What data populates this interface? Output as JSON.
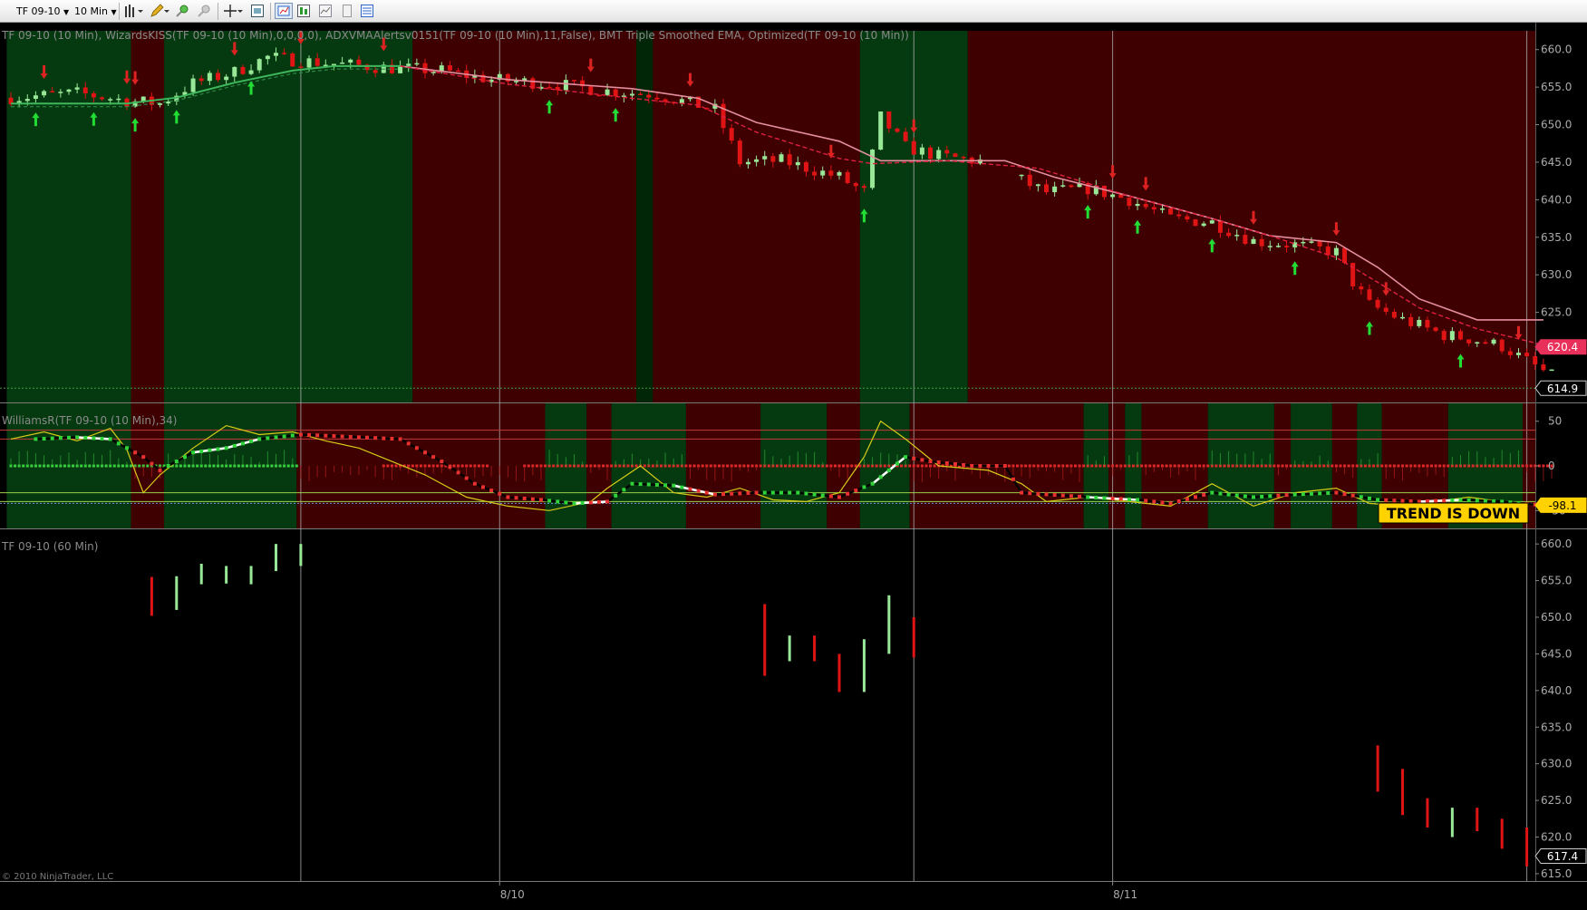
{
  "toolbar": {
    "instrument": "TF 09-10",
    "interval": "10 Min",
    "icons": [
      "bar-style-icon",
      "drawing-pencil-icon",
      "zoom-in-icon",
      "zoom-out-icon",
      "crosshair-icon",
      "data-box-icon",
      "properties-icon",
      "indicators-icon",
      "strategies-icon",
      "templates-icon",
      "chart-trader-icon"
    ]
  },
  "panels": {
    "price_title": "TF 09-10 (10 Min), WizardsKISS(TF 09-10 (10 Min),0,0,0,0), ADXVMAAlertsv0151(TF 09-10 (10 Min),11,False), BMT Triple Smoothed EMA, Optimized(TF 09-10 (10 Min))",
    "williams_title": "WilliamsR(TF 09-10 (10 Min),34)",
    "hourly_title": "TF 09-10 (60 Min)",
    "copyright": "© 2010 NinjaTrader, LLC",
    "trend_text": "TREND IS DOWN"
  },
  "chart_data": [
    {
      "type": "candlestick",
      "name": "price-10min",
      "ylim": [
        613,
        662.5
      ],
      "yticks": [
        "660.0",
        "655.0",
        "650.0",
        "645.0",
        "640.0",
        "635.0",
        "630.0",
        "625.0",
        "620.0",
        "615.0"
      ],
      "ytick_values": [
        660,
        655,
        650,
        645,
        640,
        635,
        630,
        625,
        620,
        615
      ],
      "price_markers": [
        {
          "label": "620.4",
          "value": 620.4,
          "color": "#e8305a"
        },
        {
          "label": "614.9",
          "value": 614.9,
          "color": "#000000"
        }
      ],
      "xlabels": [
        {
          "label": "8/10",
          "bar": 59
        },
        {
          "label": "8/11",
          "bar": 133
        }
      ],
      "waypoints": [
        [
          0,
          653.6
        ],
        [
          8,
          654.2
        ],
        [
          14,
          653.2
        ],
        [
          18,
          652.8
        ],
        [
          22,
          655.5
        ],
        [
          27,
          657
        ],
        [
          31,
          659
        ],
        [
          35,
          658.5
        ],
        [
          38,
          658.2
        ],
        [
          45,
          657.6
        ],
        [
          52,
          657.2
        ],
        [
          58,
          656
        ],
        [
          65,
          655.5
        ],
        [
          72,
          654.5
        ],
        [
          78,
          654
        ],
        [
          85,
          652
        ],
        [
          88,
          645
        ],
        [
          93,
          645.2
        ],
        [
          100,
          643
        ],
        [
          103,
          641
        ],
        [
          105,
          651
        ],
        [
          108,
          647
        ],
        [
          112,
          645.8
        ],
        [
          118,
          645
        ],
        [
          123,
          642
        ],
        [
          125,
          641
        ],
        [
          130,
          641.5
        ],
        [
          135,
          640
        ],
        [
          140,
          637.5
        ],
        [
          145,
          637
        ],
        [
          150,
          634.5
        ],
        [
          155,
          634
        ],
        [
          160,
          633
        ],
        [
          162,
          629
        ],
        [
          164,
          626
        ],
        [
          168,
          624
        ],
        [
          173,
          622
        ],
        [
          176,
          621.5
        ],
        [
          180,
          620.5
        ],
        [
          183,
          618.5
        ],
        [
          186,
          616.5
        ]
      ],
      "fast_line": [
        [
          0,
          652.8
        ],
        [
          14,
          652.8
        ],
        [
          20,
          653.6
        ],
        [
          27,
          655.6
        ],
        [
          34,
          657.2
        ],
        [
          39,
          657.8
        ],
        [
          47,
          657.8
        ]
      ],
      "smooth_line": [
        [
          47,
          657.8
        ],
        [
          60,
          656
        ],
        [
          75,
          654.8
        ],
        [
          83,
          653.5
        ],
        [
          90,
          650.3
        ],
        [
          100,
          647.8
        ],
        [
          105,
          645.2
        ],
        [
          113,
          645.2
        ],
        [
          120,
          645.2
        ],
        [
          126,
          643
        ],
        [
          135,
          640.5
        ],
        [
          145,
          637.5
        ],
        [
          152,
          635.2
        ],
        [
          160,
          634.3
        ],
        [
          165,
          631
        ],
        [
          170,
          626.8
        ],
        [
          177,
          624
        ],
        [
          185,
          624
        ]
      ],
      "dashed_line": [
        [
          47,
          657.8
        ],
        [
          60,
          655.4
        ],
        [
          75,
          653.5
        ],
        [
          83,
          652.6
        ],
        [
          90,
          649
        ],
        [
          100,
          645.5
        ],
        [
          104,
          644.8
        ],
        [
          113,
          645.2
        ],
        [
          124,
          644.2
        ],
        [
          135,
          640.5
        ],
        [
          145,
          637.5
        ],
        [
          152,
          635.2
        ],
        [
          160,
          632.3
        ],
        [
          165,
          629
        ],
        [
          170,
          625.6
        ],
        [
          177,
          622.8
        ],
        [
          186,
          620.4
        ]
      ],
      "bg_segments": [
        [
          0,
          15,
          "G"
        ],
        [
          15,
          19,
          "R"
        ],
        [
          19,
          49,
          "G"
        ],
        [
          49,
          103,
          "R"
        ],
        [
          103,
          116,
          "G"
        ],
        [
          116,
          188,
          "R"
        ]
      ],
      "bg_dark_bands": [
        [
          76,
          78
        ]
      ],
      "down_arrows": [
        4,
        14,
        15,
        27,
        35,
        45,
        70,
        82,
        99,
        109,
        133,
        137,
        150,
        160,
        166,
        182
      ],
      "up_arrows": [
        3,
        10,
        15,
        20,
        29,
        65,
        73,
        103,
        130,
        136,
        145,
        155,
        164,
        175
      ],
      "vertical_grid_bars": [
        35,
        59,
        109,
        133,
        183
      ]
    },
    {
      "type": "line",
      "name": "williams-r",
      "ylim": [
        -70,
        70
      ],
      "yticks": [
        "50",
        "0",
        "-50"
      ],
      "ytick_values": [
        50,
        0,
        -50
      ],
      "level_lines": [
        40,
        30,
        -30,
        -40
      ],
      "price_markers": [
        {
          "label": "-98.1",
          "value": -40,
          "color": "#ffd200"
        }
      ],
      "fast_oscillator": [
        [
          0,
          30
        ],
        [
          4,
          38
        ],
        [
          8,
          28
        ],
        [
          12,
          42
        ],
        [
          14,
          18
        ],
        [
          16,
          -30
        ],
        [
          18,
          -10
        ],
        [
          22,
          20
        ],
        [
          26,
          45
        ],
        [
          30,
          35
        ],
        [
          34,
          38
        ],
        [
          38,
          28
        ],
        [
          42,
          20
        ],
        [
          50,
          -10
        ],
        [
          55,
          -35
        ],
        [
          60,
          -45
        ],
        [
          65,
          -50
        ],
        [
          70,
          -40
        ],
        [
          72,
          -25
        ],
        [
          76,
          0
        ],
        [
          80,
          -30
        ],
        [
          84,
          -35
        ],
        [
          88,
          -25
        ],
        [
          92,
          -38
        ],
        [
          96,
          -40
        ],
        [
          100,
          -30
        ],
        [
          103,
          10
        ],
        [
          105,
          50
        ],
        [
          108,
          30
        ],
        [
          112,
          0
        ],
        [
          118,
          -5
        ],
        [
          122,
          -20
        ],
        [
          125,
          -40
        ],
        [
          130,
          -35
        ],
        [
          135,
          -40
        ],
        [
          140,
          -45
        ],
        [
          145,
          -20
        ],
        [
          148,
          -35
        ],
        [
          150,
          -45
        ],
        [
          155,
          -30
        ],
        [
          160,
          -25
        ],
        [
          164,
          -42
        ],
        [
          168,
          -45
        ],
        [
          172,
          -40
        ],
        [
          176,
          -35
        ],
        [
          180,
          -40
        ],
        [
          186,
          -45
        ]
      ],
      "slow_line": [
        [
          3,
          30
        ],
        [
          8,
          32
        ],
        [
          12,
          30
        ],
        [
          16,
          10
        ],
        [
          18,
          -5
        ],
        [
          22,
          15
        ],
        [
          26,
          20
        ],
        [
          30,
          30
        ],
        [
          35,
          35
        ],
        [
          40,
          33
        ],
        [
          47,
          30
        ],
        [
          52,
          5
        ],
        [
          56,
          -20
        ],
        [
          60,
          -35
        ],
        [
          64,
          -38
        ],
        [
          68,
          -42
        ],
        [
          72,
          -40
        ],
        [
          75,
          -20
        ],
        [
          80,
          -22
        ],
        [
          85,
          -32
        ],
        [
          90,
          -30
        ],
        [
          95,
          -30
        ],
        [
          100,
          -35
        ],
        [
          104,
          -20
        ],
        [
          108,
          10
        ],
        [
          111,
          5
        ],
        [
          116,
          0
        ],
        [
          120,
          0
        ],
        [
          122,
          -30
        ],
        [
          130,
          -35
        ],
        [
          136,
          -38
        ],
        [
          140,
          -42
        ],
        [
          145,
          -30
        ],
        [
          150,
          -35
        ],
        [
          155,
          -32
        ],
        [
          160,
          -30
        ],
        [
          165,
          -38
        ],
        [
          170,
          -40
        ],
        [
          175,
          -38
        ],
        [
          180,
          -40
        ],
        [
          186,
          -45
        ]
      ],
      "bg_segments": [
        [
          0,
          15,
          "G"
        ],
        [
          15,
          19,
          "R"
        ],
        [
          19,
          35,
          "G"
        ],
        [
          35,
          65,
          "R"
        ],
        [
          65,
          70,
          "G"
        ],
        [
          70,
          73,
          "R"
        ],
        [
          73,
          82,
          "G"
        ],
        [
          82,
          91,
          "R"
        ],
        [
          91,
          99,
          "G"
        ],
        [
          99,
          103,
          "R"
        ],
        [
          103,
          109,
          "G"
        ],
        [
          109,
          130,
          "R"
        ],
        [
          130,
          133,
          "G"
        ],
        [
          133,
          135,
          "R"
        ],
        [
          135,
          137,
          "G"
        ],
        [
          137,
          145,
          "R"
        ],
        [
          145,
          153,
          "G"
        ],
        [
          153,
          155,
          "R"
        ],
        [
          155,
          160,
          "G"
        ],
        [
          160,
          163,
          "R"
        ],
        [
          163,
          166,
          "G"
        ],
        [
          166,
          174,
          "R"
        ],
        [
          174,
          183,
          "G"
        ],
        [
          183,
          188,
          "R"
        ]
      ]
    },
    {
      "type": "ohlc",
      "name": "price-60min",
      "ylim": [
        614,
        662
      ],
      "yticks": [
        "660.0",
        "655.0",
        "650.0",
        "645.0",
        "640.0",
        "635.0",
        "630.0",
        "625.0",
        "620.0",
        "615.0"
      ],
      "ytick_values": [
        660,
        655,
        650,
        645,
        640,
        635,
        630,
        625,
        620,
        615
      ],
      "price_markers": [
        {
          "label": "617.4",
          "value": 617.4,
          "color": "#000000"
        }
      ],
      "bars": [
        {
          "bar": 17,
          "open": 655.5,
          "close": 650.2,
          "high": 655.5,
          "low": 650.2
        },
        {
          "bar": 20,
          "open": 651,
          "close": 655.6,
          "high": 655.6,
          "low": 651
        },
        {
          "bar": 23,
          "open": 654.5,
          "close": 657.3,
          "high": 657.3,
          "low": 654.5
        },
        {
          "bar": 26,
          "open": 654.6,
          "close": 657,
          "high": 657,
          "low": 654.6
        },
        {
          "bar": 29,
          "open": 654.5,
          "close": 657,
          "high": 657,
          "low": 654.5
        },
        {
          "bar": 32,
          "open": 656.3,
          "close": 660,
          "high": 660,
          "low": 656.3
        },
        {
          "bar": 35,
          "open": 657,
          "close": 660,
          "high": 660,
          "low": 657
        },
        {
          "bar": 91,
          "open": 651.8,
          "close": 642,
          "high": 651.8,
          "low": 642
        },
        {
          "bar": 94,
          "open": 644,
          "close": 647.5,
          "high": 647.5,
          "low": 644
        },
        {
          "bar": 97,
          "open": 647.5,
          "close": 644,
          "high": 647.5,
          "low": 644
        },
        {
          "bar": 100,
          "open": 645,
          "close": 639.8,
          "high": 645,
          "low": 639.8
        },
        {
          "bar": 103,
          "open": 639.8,
          "close": 647,
          "high": 647,
          "low": 639.8
        },
        {
          "bar": 106,
          "open": 645,
          "close": 653,
          "high": 653,
          "low": 645
        },
        {
          "bar": 109,
          "open": 650,
          "close": 644.5,
          "high": 650,
          "low": 644.5
        },
        {
          "bar": 165,
          "open": 632.5,
          "close": 626.2,
          "high": 632.5,
          "low": 626.2
        },
        {
          "bar": 168,
          "open": 629.3,
          "close": 623,
          "high": 629.3,
          "low": 623
        },
        {
          "bar": 171,
          "open": 625.3,
          "close": 621.3,
          "high": 625.3,
          "low": 621.3
        },
        {
          "bar": 174,
          "open": 620,
          "close": 624,
          "high": 624,
          "low": 620
        },
        {
          "bar": 177,
          "open": 624,
          "close": 620.8,
          "high": 624,
          "low": 620.8
        },
        {
          "bar": 180,
          "open": 622.5,
          "close": 618.4,
          "high": 622.5,
          "low": 618.4
        },
        {
          "bar": 183,
          "open": 621.3,
          "close": 616,
          "high": 621.3,
          "low": 616
        }
      ]
    }
  ],
  "colors": {
    "bg_green": "#053a10",
    "bg_red": "#3e0000",
    "bg_dark_green": "#012507",
    "up_candle": "#98e898",
    "down_candle": "#e01414",
    "arrow_up": "#22dd33",
    "arrow_down": "#dd2222",
    "green_line": "#3fb65b",
    "pink_line": "#e48ea0",
    "dashed_line": "#e02040",
    "yellow_osc": "#d6cc18",
    "axis_text": "#aaaaaa",
    "trend_box": "#ffd200"
  }
}
